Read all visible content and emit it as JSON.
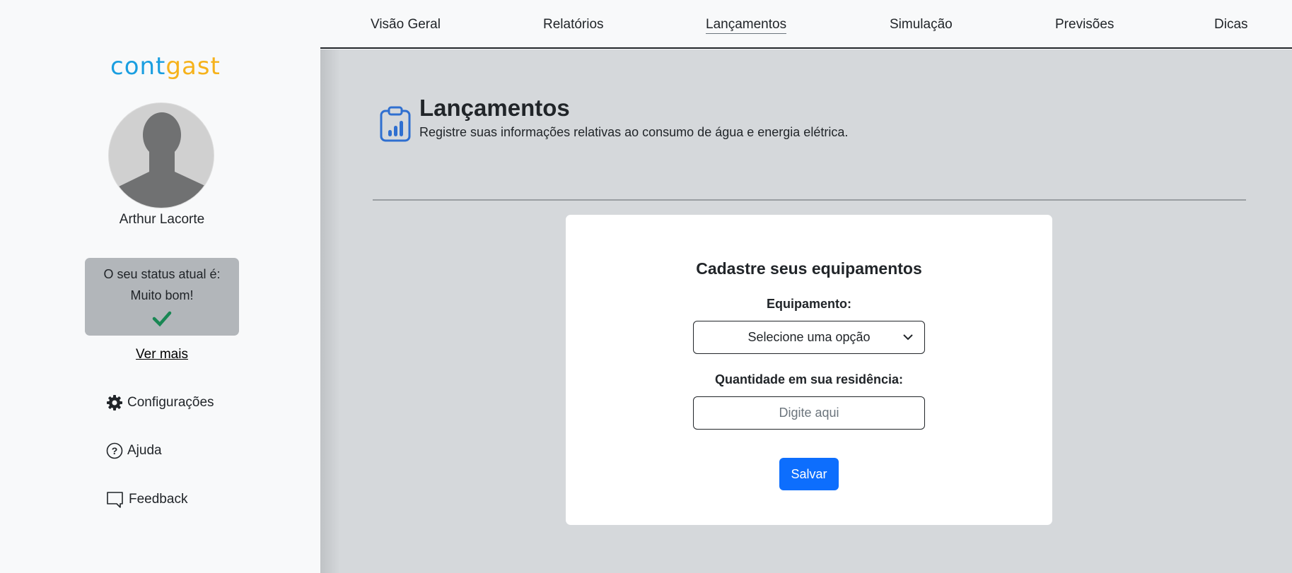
{
  "nav": {
    "items": [
      {
        "label": "Visão Geral"
      },
      {
        "label": "Relatórios"
      },
      {
        "label": "Lançamentos",
        "active": true
      },
      {
        "label": "Simulação"
      },
      {
        "label": "Previsões"
      },
      {
        "label": "Dicas"
      }
    ]
  },
  "sidebar": {
    "logo": {
      "part1": "cont",
      "part2": "gast"
    },
    "user_name": "Arthur Lacorte",
    "status": {
      "label": "O seu status atual é:",
      "value": "Muito bom!"
    },
    "ver_mais": "Ver mais",
    "items": [
      {
        "label": "Configurações",
        "icon": "gear-icon"
      },
      {
        "label": "Ajuda",
        "icon": "help-circle-icon"
      },
      {
        "label": "Feedback",
        "icon": "chat-icon"
      }
    ]
  },
  "page": {
    "title": "Lançamentos",
    "subtitle": "Registre suas informações relativas ao consumo de água e energia elétrica."
  },
  "form": {
    "title": "Cadastre seus equipamentos",
    "equipment_label": "Equipamento:",
    "equipment_value": "Selecione uma opção",
    "quantity_label": "Quantidade em sua residência:",
    "quantity_placeholder": "Digite aqui",
    "save_label": "Salvar"
  },
  "colors": {
    "accent": "#0d6efd",
    "success": "#198754",
    "main_bg": "#d5d8db"
  }
}
